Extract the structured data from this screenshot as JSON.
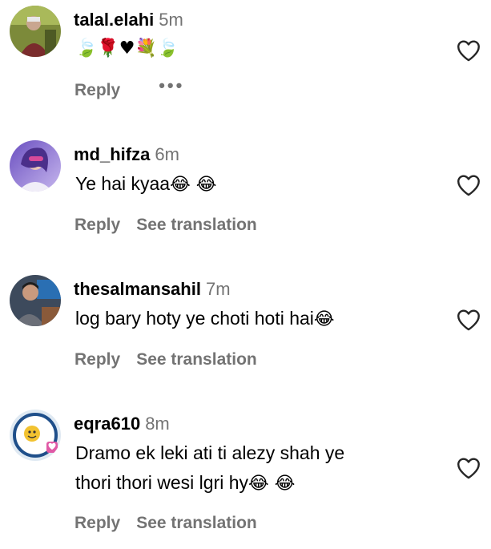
{
  "comments": [
    {
      "username": "talal.elahi",
      "time": "5m",
      "text": "🍃🌹♥💐🍃",
      "reply_label": "Reply",
      "more_label": "•••"
    },
    {
      "username": "md_hifza",
      "time": "6m",
      "text": "Ye hai kyaa",
      "emoji": "😂 😂",
      "reply_label": "Reply",
      "translation_label": "See translation"
    },
    {
      "username": "thesalmansahil",
      "time": "7m",
      "text": "log bary hoty ye choti hoti hai",
      "emoji": "😂",
      "reply_label": "Reply",
      "translation_label": "See translation"
    },
    {
      "username": "eqra610",
      "time": "8m",
      "text_line1": "Dramo ek leki ati ti alezy shah ye",
      "text_line2": "thori thori wesi lgri hy",
      "emoji": "😂 😂",
      "reply_label": "Reply",
      "translation_label": "See translation"
    }
  ],
  "icons": {
    "like": "heart-outline-icon",
    "more": "more-dots-icon"
  },
  "colors": {
    "text": "#000000",
    "secondary": "#737373",
    "heart_stroke": "#262626"
  }
}
